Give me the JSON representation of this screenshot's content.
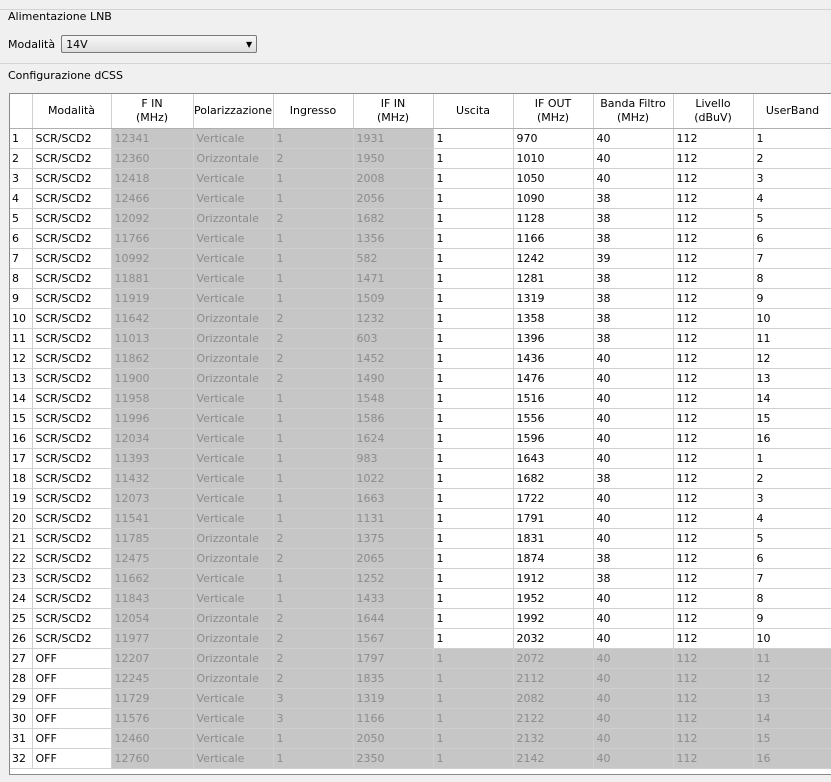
{
  "lnb": {
    "group_title": "Alimentazione LNB",
    "mode_label": "Modalità",
    "mode_value": "14V"
  },
  "dcss": {
    "group_title": "Configurazione dCSS",
    "columns": [
      "",
      "Modalità",
      "F IN\n(MHz)",
      "Polarizzazione",
      "Ingresso",
      "IF IN\n(MHz)",
      "Uscita",
      "IF OUT\n(MHz)",
      "Banda Filtro\n(MHz)",
      "Livello\n(dBuV)",
      "UserBand"
    ],
    "rows": [
      [
        "1",
        "SCR/SCD2",
        "12341",
        "Verticale",
        "1",
        "1931",
        "1",
        "970",
        "40",
        "112",
        "1"
      ],
      [
        "2",
        "SCR/SCD2",
        "12360",
        "Orizzontale",
        "2",
        "1950",
        "1",
        "1010",
        "40",
        "112",
        "2"
      ],
      [
        "3",
        "SCR/SCD2",
        "12418",
        "Verticale",
        "1",
        "2008",
        "1",
        "1050",
        "40",
        "112",
        "3"
      ],
      [
        "4",
        "SCR/SCD2",
        "12466",
        "Verticale",
        "1",
        "2056",
        "1",
        "1090",
        "38",
        "112",
        "4"
      ],
      [
        "5",
        "SCR/SCD2",
        "12092",
        "Orizzontale",
        "2",
        "1682",
        "1",
        "1128",
        "38",
        "112",
        "5"
      ],
      [
        "6",
        "SCR/SCD2",
        "11766",
        "Verticale",
        "1",
        "1356",
        "1",
        "1166",
        "38",
        "112",
        "6"
      ],
      [
        "7",
        "SCR/SCD2",
        "10992",
        "Verticale",
        "1",
        "582",
        "1",
        "1242",
        "39",
        "112",
        "7"
      ],
      [
        "8",
        "SCR/SCD2",
        "11881",
        "Verticale",
        "1",
        "1471",
        "1",
        "1281",
        "38",
        "112",
        "8"
      ],
      [
        "9",
        "SCR/SCD2",
        "11919",
        "Verticale",
        "1",
        "1509",
        "1",
        "1319",
        "38",
        "112",
        "9"
      ],
      [
        "10",
        "SCR/SCD2",
        "11642",
        "Orizzontale",
        "2",
        "1232",
        "1",
        "1358",
        "38",
        "112",
        "10"
      ],
      [
        "11",
        "SCR/SCD2",
        "11013",
        "Orizzontale",
        "2",
        "603",
        "1",
        "1396",
        "38",
        "112",
        "11"
      ],
      [
        "12",
        "SCR/SCD2",
        "11862",
        "Orizzontale",
        "2",
        "1452",
        "1",
        "1436",
        "40",
        "112",
        "12"
      ],
      [
        "13",
        "SCR/SCD2",
        "11900",
        "Orizzontale",
        "2",
        "1490",
        "1",
        "1476",
        "40",
        "112",
        "13"
      ],
      [
        "14",
        "SCR/SCD2",
        "11958",
        "Verticale",
        "1",
        "1548",
        "1",
        "1516",
        "40",
        "112",
        "14"
      ],
      [
        "15",
        "SCR/SCD2",
        "11996",
        "Verticale",
        "1",
        "1586",
        "1",
        "1556",
        "40",
        "112",
        "15"
      ],
      [
        "16",
        "SCR/SCD2",
        "12034",
        "Verticale",
        "1",
        "1624",
        "1",
        "1596",
        "40",
        "112",
        "16"
      ],
      [
        "17",
        "SCR/SCD2",
        "11393",
        "Verticale",
        "1",
        "983",
        "1",
        "1643",
        "40",
        "112",
        "1"
      ],
      [
        "18",
        "SCR/SCD2",
        "11432",
        "Verticale",
        "1",
        "1022",
        "1",
        "1682",
        "38",
        "112",
        "2"
      ],
      [
        "19",
        "SCR/SCD2",
        "12073",
        "Verticale",
        "1",
        "1663",
        "1",
        "1722",
        "40",
        "112",
        "3"
      ],
      [
        "20",
        "SCR/SCD2",
        "11541",
        "Verticale",
        "1",
        "1131",
        "1",
        "1791",
        "40",
        "112",
        "4"
      ],
      [
        "21",
        "SCR/SCD2",
        "11785",
        "Orizzontale",
        "2",
        "1375",
        "1",
        "1831",
        "40",
        "112",
        "5"
      ],
      [
        "22",
        "SCR/SCD2",
        "12475",
        "Orizzontale",
        "2",
        "2065",
        "1",
        "1874",
        "38",
        "112",
        "6"
      ],
      [
        "23",
        "SCR/SCD2",
        "11662",
        "Verticale",
        "1",
        "1252",
        "1",
        "1912",
        "38",
        "112",
        "7"
      ],
      [
        "24",
        "SCR/SCD2",
        "11843",
        "Verticale",
        "1",
        "1433",
        "1",
        "1952",
        "40",
        "112",
        "8"
      ],
      [
        "25",
        "SCR/SCD2",
        "12054",
        "Orizzontale",
        "2",
        "1644",
        "1",
        "1992",
        "40",
        "112",
        "9"
      ],
      [
        "26",
        "SCR/SCD2",
        "11977",
        "Orizzontale",
        "2",
        "1567",
        "1",
        "2032",
        "40",
        "112",
        "10"
      ],
      [
        "27",
        "OFF",
        "12207",
        "Orizzontale",
        "2",
        "1797",
        "1",
        "2072",
        "40",
        "112",
        "11"
      ],
      [
        "28",
        "OFF",
        "12245",
        "Orizzontale",
        "2",
        "1835",
        "1",
        "2112",
        "40",
        "112",
        "12"
      ],
      [
        "29",
        "OFF",
        "11729",
        "Verticale",
        "3",
        "1319",
        "1",
        "2082",
        "40",
        "112",
        "13"
      ],
      [
        "30",
        "OFF",
        "11576",
        "Verticale",
        "3",
        "1166",
        "1",
        "2122",
        "40",
        "112",
        "14"
      ],
      [
        "31",
        "OFF",
        "12460",
        "Verticale",
        "1",
        "2050",
        "1",
        "2132",
        "40",
        "112",
        "15"
      ],
      [
        "32",
        "OFF",
        "12760",
        "Verticale",
        "1",
        "2350",
        "1",
        "2142",
        "40",
        "112",
        "16"
      ]
    ]
  },
  "colors": {
    "disabled_bg": "#c6c6c6",
    "disabled_text": "#8c8c8c",
    "window_bg": "#f0f0f0"
  }
}
